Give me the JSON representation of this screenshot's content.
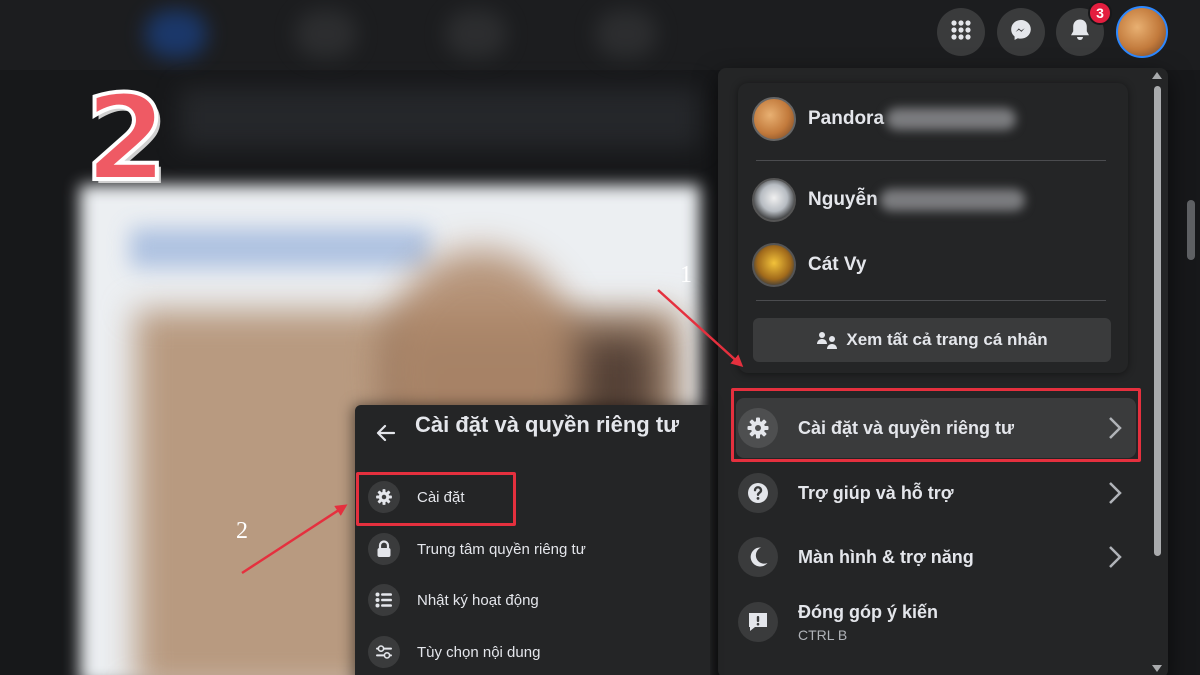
{
  "step_badge": "2",
  "topbar": {
    "icons": [
      "menu-grid-icon",
      "messenger-icon",
      "bell-icon"
    ],
    "notification_count": "3"
  },
  "account_menu": {
    "profiles": [
      {
        "name": "Pandora",
        "avatar": "cat-photo"
      },
      {
        "name": "Nguyễn",
        "avatar": "white-cat-photo"
      },
      {
        "name": "Cát Vy",
        "avatar": "yellow-photo"
      }
    ],
    "see_all_label": "Xem tất cả trang cá nhân",
    "items": [
      {
        "label": "Cài đặt và quyền riêng tư",
        "icon": "gear-icon",
        "has_chevron": true
      },
      {
        "label": "Trợ giúp và hỗ trợ",
        "icon": "question-icon",
        "has_chevron": true
      },
      {
        "label": "Màn hình & trợ năng",
        "icon": "moon-icon",
        "has_chevron": true
      },
      {
        "label": "Đóng góp ý kiến",
        "sublabel": "CTRL B",
        "icon": "feedback-icon",
        "has_chevron": false
      }
    ]
  },
  "settings_submenu": {
    "title": "Cài đặt và quyền riêng tư",
    "items": [
      {
        "label": "Cài đặt",
        "icon": "gear-icon"
      },
      {
        "label": "Trung tâm quyền riêng tư",
        "icon": "lock-icon"
      },
      {
        "label": "Nhật ký hoạt động",
        "icon": "list-icon"
      },
      {
        "label": "Tùy chọn nội dung",
        "icon": "sliders-icon"
      }
    ]
  },
  "annotations": {
    "step1": "1",
    "step2": "2",
    "highlight_color": "#e5303e"
  }
}
